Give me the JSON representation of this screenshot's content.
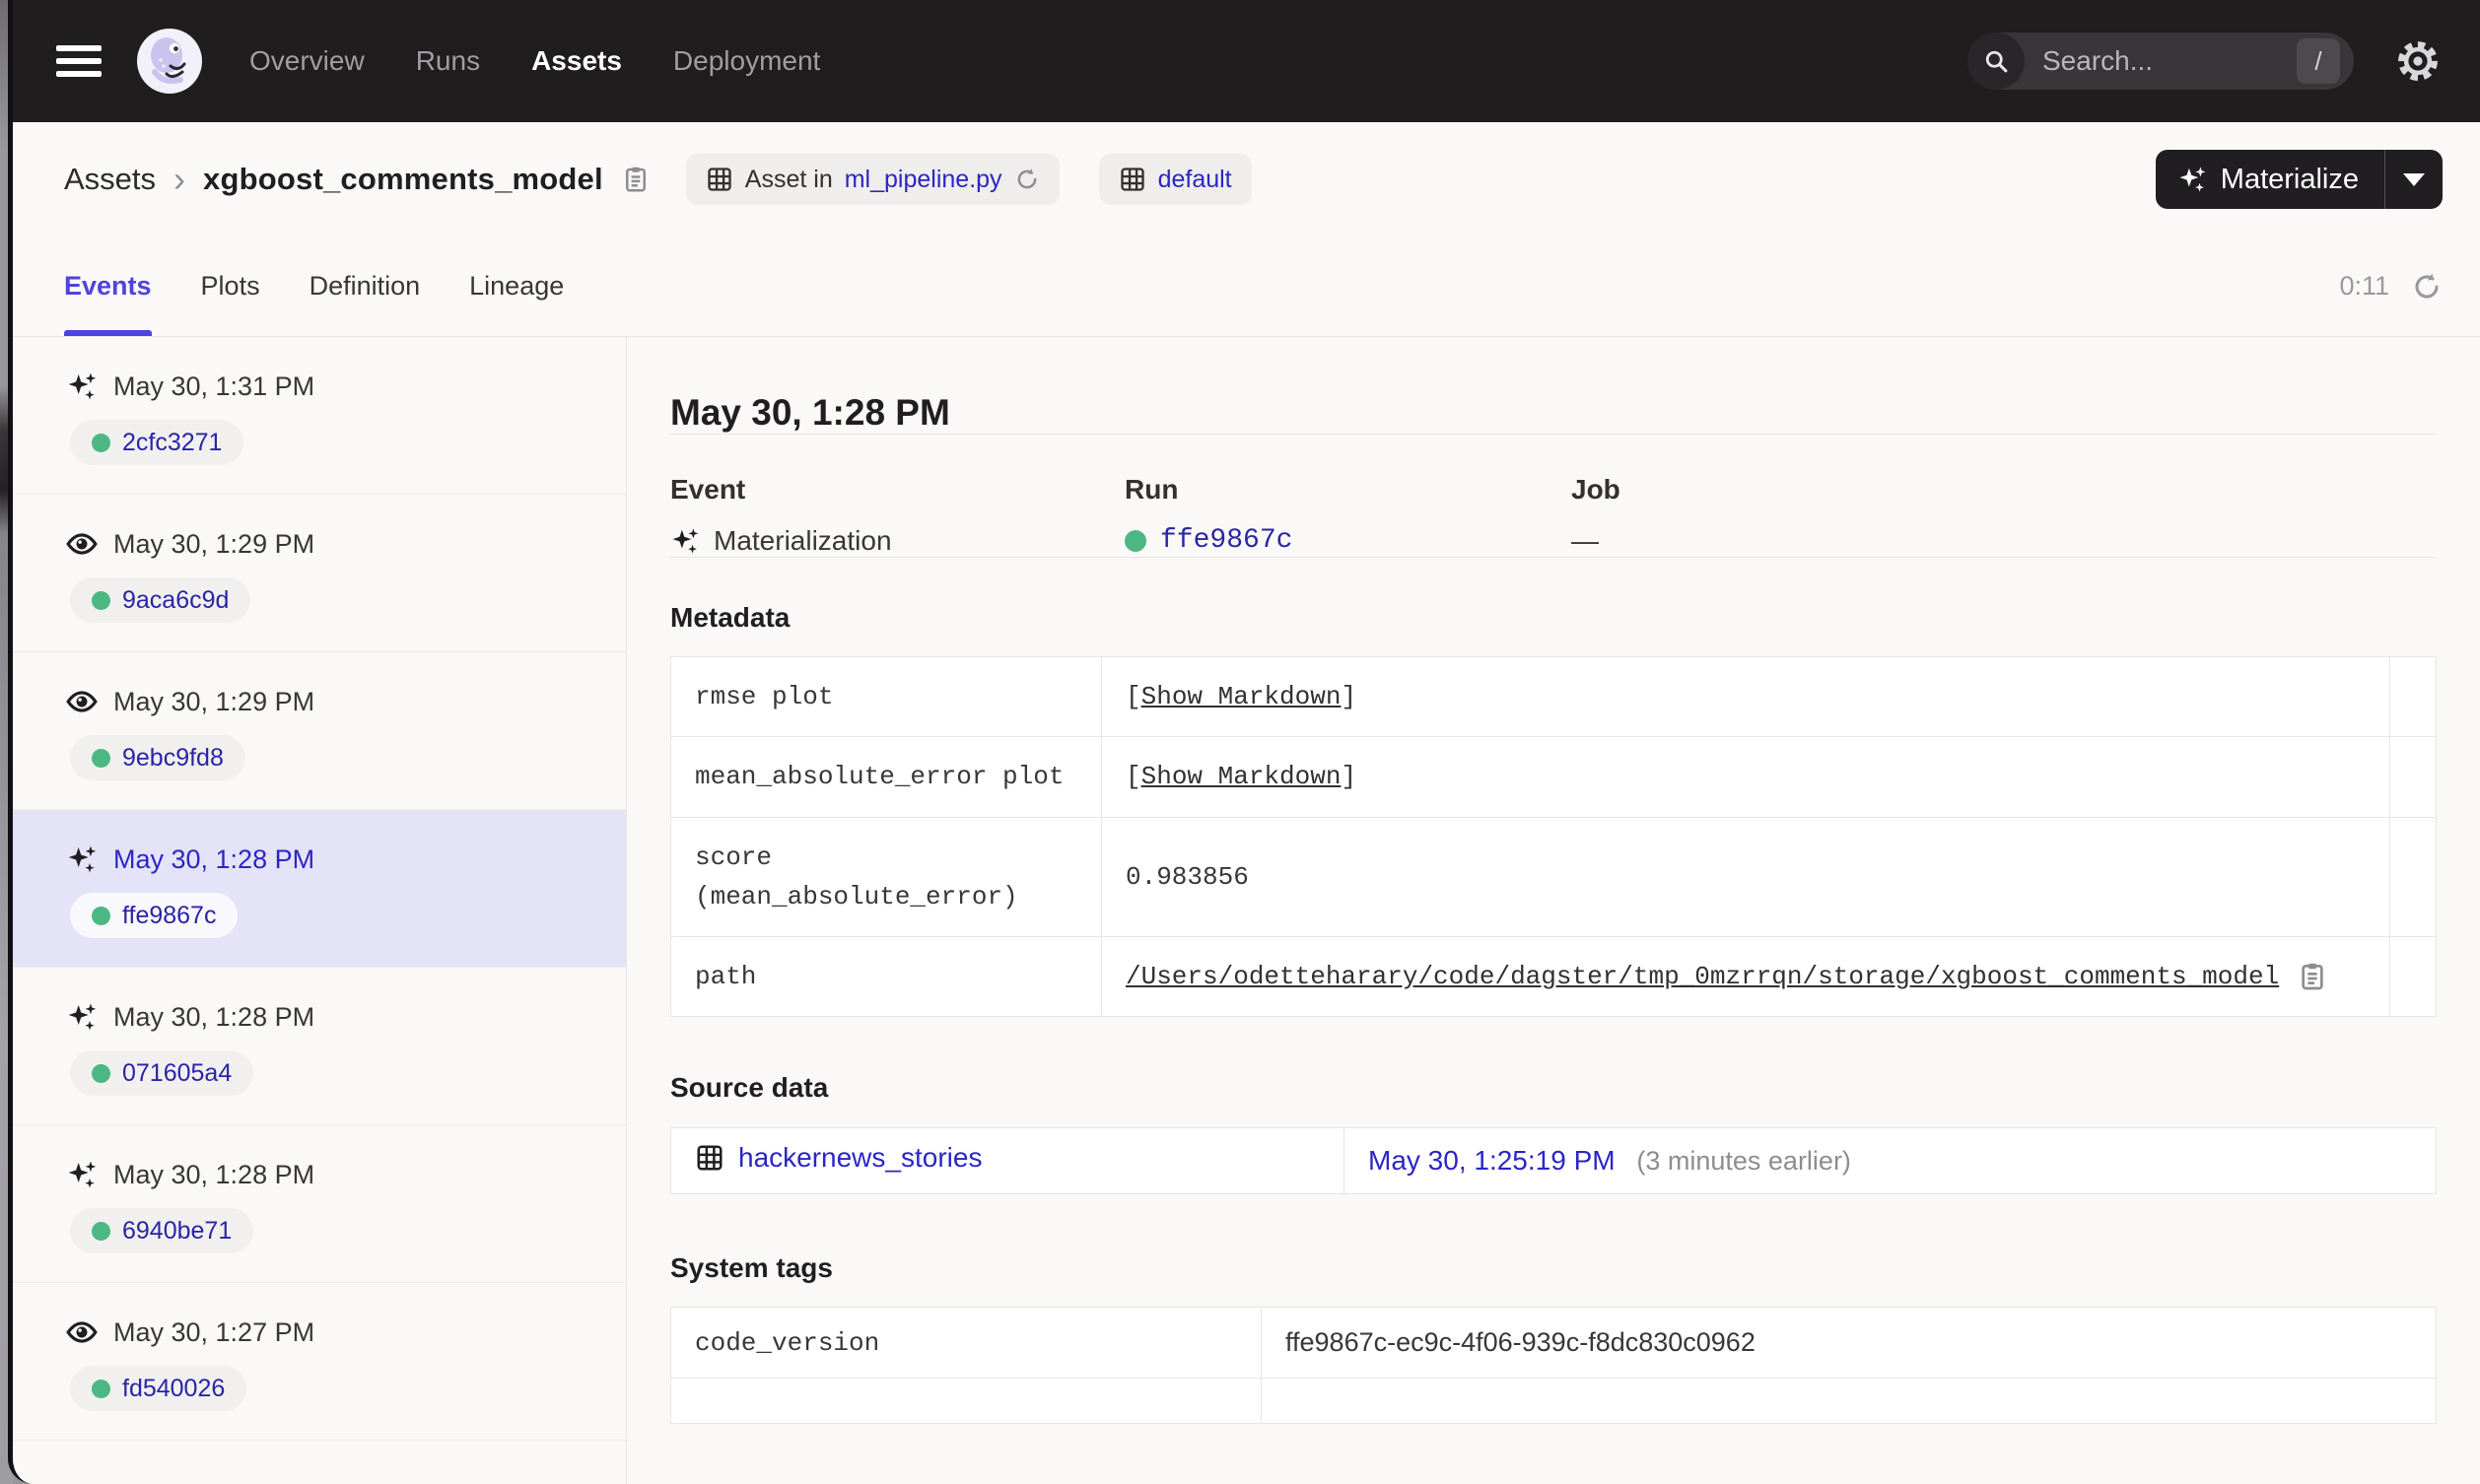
{
  "colors": {
    "navbar_bg": "#201D1F",
    "page_bg": "#FAF9F7",
    "accent_blurple": "#4F43DD",
    "link_blue": "#2B26C6",
    "run_id_blue": "#2A25A5",
    "success_green": "#4CB782",
    "selected_row_bg": "#E5E3F7",
    "border": "#E7E6E3",
    "button_bg": "#211E21"
  },
  "nav": {
    "items": [
      {
        "label": "Overview",
        "active": false
      },
      {
        "label": "Runs",
        "active": false
      },
      {
        "label": "Assets",
        "active": true
      },
      {
        "label": "Deployment",
        "active": false
      }
    ],
    "search": {
      "placeholder": "Search...",
      "shortcut": "/"
    },
    "icons": [
      "hamburger-icon",
      "dagster-logo",
      "search-icon",
      "gear-icon"
    ]
  },
  "header": {
    "breadcrumb_root": "Assets",
    "breadcrumb_separator": "›",
    "title": "xgboost_comments_model",
    "asset_badge": {
      "prefix": "Asset in",
      "link": "ml_pipeline.py",
      "icons": [
        "asset-grid-icon",
        "refresh-icon"
      ]
    },
    "group_badge": {
      "label": "default",
      "icon": "asset-group-icon"
    },
    "materialize": {
      "label": "Materialize",
      "icon": "sparkle-icon"
    }
  },
  "tabs": {
    "items": [
      {
        "label": "Events",
        "active": true
      },
      {
        "label": "Plots",
        "active": false
      },
      {
        "label": "Definition",
        "active": false
      },
      {
        "label": "Lineage",
        "active": false
      }
    ],
    "timer": "0:11",
    "refresh_icon": "refresh-icon"
  },
  "sidebar": {
    "events": [
      {
        "icon": "sparkle",
        "time": "May 30, 1:31 PM",
        "run": "2cfc3271",
        "selected": false
      },
      {
        "icon": "eye",
        "time": "May 30, 1:29 PM",
        "run": "9aca6c9d",
        "selected": false
      },
      {
        "icon": "eye",
        "time": "May 30, 1:29 PM",
        "run": "9ebc9fd8",
        "selected": false
      },
      {
        "icon": "sparkle",
        "time": "May 30, 1:28 PM",
        "run": "ffe9867c",
        "selected": true
      },
      {
        "icon": "sparkle",
        "time": "May 30, 1:28 PM",
        "run": "071605a4",
        "selected": false
      },
      {
        "icon": "sparkle",
        "time": "May 30, 1:28 PM",
        "run": "6940be71",
        "selected": false
      },
      {
        "icon": "eye",
        "time": "May 30, 1:27 PM",
        "run": "fd540026",
        "selected": false
      }
    ]
  },
  "detail": {
    "title": "May 30, 1:28 PM",
    "columns": {
      "event_label": "Event",
      "event_value": "Materialization",
      "event_icon": "sparkle-icon",
      "run_label": "Run",
      "run_value": "ffe9867c",
      "job_label": "Job",
      "job_value": "—"
    },
    "metadata": {
      "title": "Metadata",
      "rows": [
        {
          "key": "rmse plot",
          "kind": "markdown",
          "bracket_open": "[",
          "link_label": "Show Markdown",
          "bracket_close": "]"
        },
        {
          "key": "mean_absolute_error plot",
          "kind": "markdown",
          "bracket_open": "[",
          "link_label": "Show Markdown",
          "bracket_close": "]"
        },
        {
          "key": "score (mean_absolute_error)",
          "kind": "text",
          "value": "0.983856"
        },
        {
          "key": "path",
          "kind": "path",
          "value": "/Users/odetteharary/code/dagster/tmp_0mzrrqn/storage/xgboost_comments_model"
        }
      ]
    },
    "source_data": {
      "title": "Source data",
      "rows": [
        {
          "asset": "hackernews_stories",
          "time": "May 30, 1:25:19 PM",
          "relative": "(3 minutes earlier)"
        }
      ]
    },
    "system_tags": {
      "title": "System tags",
      "rows": [
        {
          "key": "code_version",
          "value": "ffe9867c-ec9c-4f06-939c-f8dc830c0962"
        }
      ]
    }
  }
}
